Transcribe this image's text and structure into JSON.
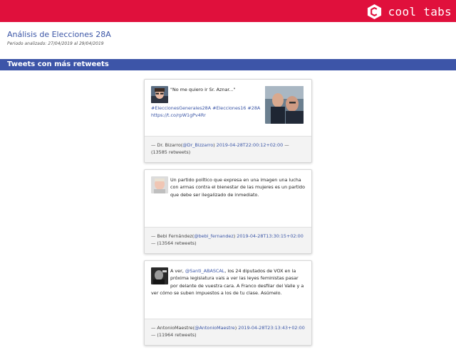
{
  "brand": {
    "name": "cool tabs",
    "logo": "coolTabs-hexagon-logo"
  },
  "report": {
    "title": "Análisis de Elecciones 28A",
    "period_label": "Periodo analizado:",
    "period_value": "27/04/2019 al 29/04/2019"
  },
  "section": {
    "title": "Tweets con más retweets"
  },
  "tweets": [
    {
      "text_lead": "\"No me quiero ir Sr. Aznar...\"",
      "hashtags": "#EleccionesGenerales28A #Elecciones16 #28A",
      "url": "https://t.co/rpW1gPv4Rr",
      "author_name": "— Dr. Bizarro(",
      "handle": "@Dr_Bizzarro",
      "close_paren": ")",
      "timestamp": "2019-04-28T22:00:12+02:00",
      "dash": "—",
      "retweets": "(13585 retweets)"
    },
    {
      "text": "Un partido político que expresa en una imagen una lucha con armas contra el bienestar de las mujeres es un partido que debe ser ilegalizado de inmediato.",
      "author_name": "— Bebi Fernández(",
      "handle": "@bebi_fernandez",
      "close_paren": ")",
      "timestamp": "2019-04-28T13:30:15+02:00",
      "retweets": "— (13564 retweets)"
    },
    {
      "text_pre": "A ver, ",
      "mention": "@Santi_ABASCAL",
      "text_post": ", los 24 diputados de VOX en la próxima legislatura vais a ver las leyes feministas pasar por delante de vuestra cara. A Franco desfilar del Valle y a ver cómo se suben impuestos a los de tu clase. Asúmelo.",
      "author_name": "— AntonioMaestre(",
      "handle": "@AntonioMaestre",
      "close_paren": ")",
      "timestamp": "2019-04-28T23:13:43+02:00",
      "retweets": "— (11964 retweets)"
    }
  ],
  "colors": {
    "topbar": "#e0103c",
    "section_bar": "#3d55a8",
    "link": "#3a55a6"
  }
}
